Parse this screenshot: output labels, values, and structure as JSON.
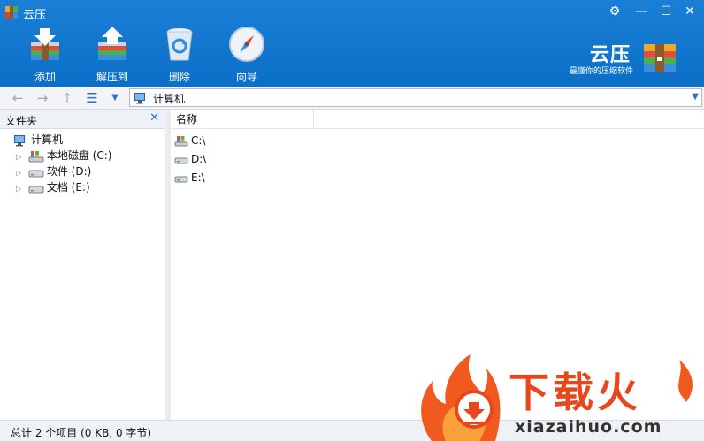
{
  "window": {
    "title": "云压"
  },
  "titlebar": {
    "settings_glyph": "⚙",
    "min_glyph": "—",
    "max_glyph": "☐",
    "close_glyph": "✕"
  },
  "toolbar": {
    "add_label": "添加",
    "extract_label": "解压到",
    "delete_label": "删除",
    "wizard_label": "向导"
  },
  "brand": {
    "name": "云压",
    "slogan": "最懂你的压缩软件"
  },
  "nav": {
    "back_glyph": "←",
    "forward_glyph": "→",
    "up_glyph": "↑",
    "view_glyph": "☰",
    "view_dd_glyph": "▼",
    "address": "计算机",
    "address_dd_glyph": "▼"
  },
  "folders": {
    "title": "文件夹",
    "close_glyph": "✕",
    "items": [
      {
        "label": "计算机",
        "icon": "computer-icon"
      },
      {
        "label": "本地磁盘 (C:)",
        "icon": "system-drive-icon",
        "expander": "▷"
      },
      {
        "label": "软件 (D:)",
        "icon": "drive-icon",
        "expander": "▷"
      },
      {
        "label": "文档 (E:)",
        "icon": "drive-icon",
        "expander": "▷"
      }
    ]
  },
  "files": {
    "column_name": "名称",
    "rows": [
      {
        "name": "C:\\",
        "icon": "system-drive-icon"
      },
      {
        "name": "D:\\",
        "icon": "drive-icon"
      },
      {
        "name": "E:\\",
        "icon": "drive-icon"
      }
    ]
  },
  "status": {
    "text": "总计 2 个项目 (0 KB, 0 字节)"
  },
  "watermark": {
    "main": "下载火",
    "sub": "xiazaihuo.com"
  },
  "colors": {
    "titlebar": "#0c6fc7",
    "accent": "#2b6fd0",
    "watermark": "#e8461c"
  }
}
